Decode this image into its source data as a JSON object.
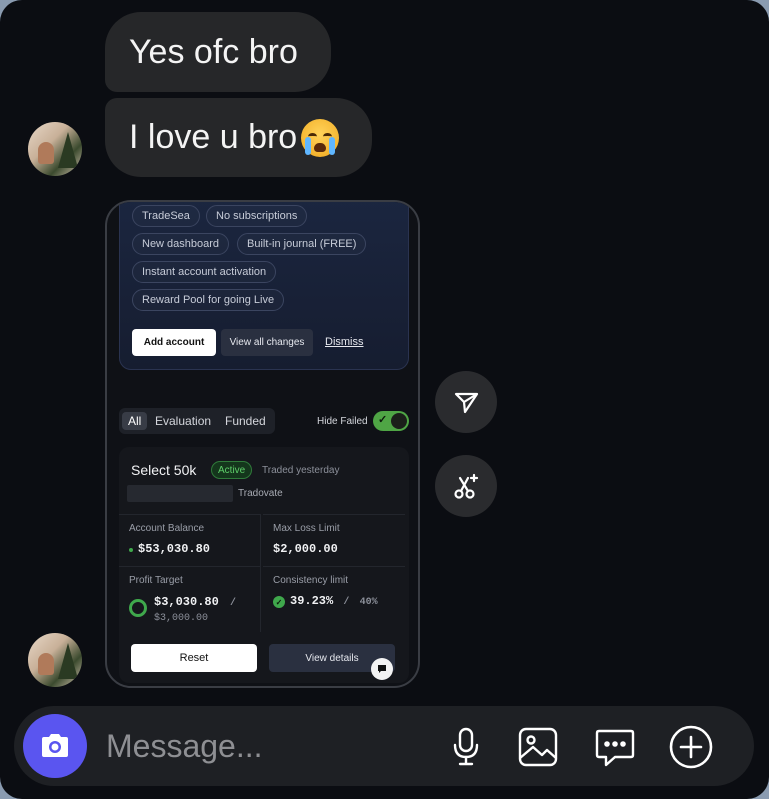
{
  "messages": [
    {
      "text": "Yes ofc bro"
    },
    {
      "text": "I love u bro",
      "emoji": "loudly-crying-face"
    }
  ],
  "shared_screenshot": {
    "chips": [
      "TradeSea",
      "No subscriptions",
      "New dashboard",
      "Built-in journal (FREE)",
      "Instant account activation",
      "Reward Pool for going Live"
    ],
    "add_account": "Add account",
    "view_all_changes": "View all changes",
    "dismiss": "Dismiss",
    "tabs": [
      "All",
      "Evaluation",
      "Funded"
    ],
    "hide_failed": "Hide Failed",
    "hide_failed_on": true,
    "account": {
      "name": "Select 50k",
      "status": "Active",
      "traded": "Traded yesterday",
      "platform": "Tradovate",
      "balance_label": "Account Balance",
      "balance": "$53,030.80",
      "max_loss_label": "Max Loss Limit",
      "max_loss": "$2,000.00",
      "profit_target_label": "Profit Target",
      "profit_target": "$3,030.80",
      "profit_target_sep": "/",
      "profit_target_goal": "$3,000.00",
      "consistency_label": "Consistency limit",
      "consistency": "39.23%",
      "consistency_sep": "/",
      "consistency_max": "40%",
      "reset": "Reset",
      "view_details": "View details"
    }
  },
  "composer": {
    "placeholder": "Message..."
  },
  "colors": {
    "accent": "#5a55f0",
    "bubble": "#262729",
    "success": "#3fa84c"
  },
  "icons": [
    "camera-icon",
    "microphone-icon",
    "image-icon",
    "chat-icon",
    "add-icon",
    "send-icon",
    "ai-edit-icon"
  ]
}
